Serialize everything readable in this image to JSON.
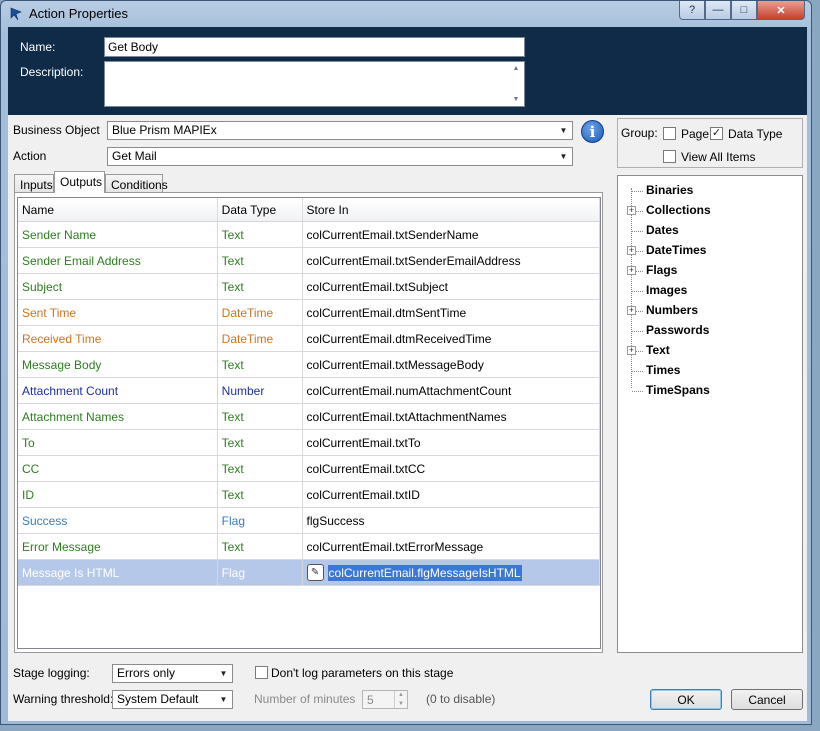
{
  "window": {
    "title": "Action Properties"
  },
  "header": {
    "name_label": "Name:",
    "name_value": "Get Body",
    "description_label": "Description:",
    "description_value": ""
  },
  "business_object": {
    "label": "Business Object",
    "value": "Blue Prism MAPIEx"
  },
  "action": {
    "label": "Action",
    "value": "Get Mail"
  },
  "tabs": [
    {
      "label": "Inputs"
    },
    {
      "label": "Outputs"
    },
    {
      "label": "Conditions"
    }
  ],
  "grid": {
    "columns": [
      "Name",
      "Data Type",
      "Store In"
    ],
    "rows": [
      {
        "name": "Sender Name",
        "type": "Text",
        "store": "colCurrentEmail.txtSenderName",
        "color": "#2e7d1f"
      },
      {
        "name": "Sender Email Address",
        "type": "Text",
        "store": "colCurrentEmail.txtSenderEmailAddress",
        "color": "#2e7d1f"
      },
      {
        "name": "Subject",
        "type": "Text",
        "store": "colCurrentEmail.txtSubject",
        "color": "#2e7d1f"
      },
      {
        "name": "Sent Time",
        "type": "DateTime",
        "store": "colCurrentEmail.dtmSentTime",
        "color": "#d4731a"
      },
      {
        "name": "Received Time",
        "type": "DateTime",
        "store": "colCurrentEmail.dtmReceivedTime",
        "color": "#d4731a"
      },
      {
        "name": "Message Body",
        "type": "Text",
        "store": "colCurrentEmail.txtMessageBody",
        "color": "#2e7d1f"
      },
      {
        "name": "Attachment Count",
        "type": "Number",
        "store": "colCurrentEmail.numAttachmentCount",
        "color": "#1c2fa8"
      },
      {
        "name": "Attachment Names",
        "type": "Text",
        "store": "colCurrentEmail.txtAttachmentNames",
        "color": "#2e7d1f"
      },
      {
        "name": "To",
        "type": "Text",
        "store": "colCurrentEmail.txtTo",
        "color": "#2e7d1f"
      },
      {
        "name": "CC",
        "type": "Text",
        "store": "colCurrentEmail.txtCC",
        "color": "#2e7d1f"
      },
      {
        "name": "ID",
        "type": "Text",
        "store": "colCurrentEmail.txtID",
        "color": "#2e7d1f"
      },
      {
        "name": "Success",
        "type": "Flag",
        "store": "flgSuccess",
        "color": "#3b7cb8"
      },
      {
        "name": "Error Message",
        "type": "Text",
        "store": "colCurrentEmail.txtErrorMessage",
        "color": "#2e7d1f"
      },
      {
        "name": "Message Is HTML",
        "type": "Flag",
        "store": "colCurrentEmail.flgMessageIsHTML",
        "color": "#ffffff"
      }
    ]
  },
  "group": {
    "label": "Group:",
    "page_label": "Page",
    "page_checked": false,
    "datatype_label": "Data Type",
    "datatype_checked": true,
    "view_all_label": "View All Items",
    "view_all_checked": false
  },
  "tree": [
    {
      "label": "Binaries",
      "expandable": false
    },
    {
      "label": "Collections",
      "expandable": true
    },
    {
      "label": "Dates",
      "expandable": false
    },
    {
      "label": "DateTimes",
      "expandable": true
    },
    {
      "label": "Flags",
      "expandable": true
    },
    {
      "label": "Images",
      "expandable": false
    },
    {
      "label": "Numbers",
      "expandable": true
    },
    {
      "label": "Passwords",
      "expandable": false
    },
    {
      "label": "Text",
      "expandable": true
    },
    {
      "label": "Times",
      "expandable": false
    },
    {
      "label": "TimeSpans",
      "expandable": false
    }
  ],
  "footer": {
    "stage_logging_label": "Stage logging:",
    "stage_logging_value": "Errors only",
    "dont_log_label": "Don't log parameters on this stage",
    "warning_label": "Warning threshold:",
    "warning_value": "System Default",
    "minutes_label": "Number of minutes",
    "minutes_value": "5",
    "disable_hint": "(0 to disable)",
    "ok_label": "OK",
    "cancel_label": "Cancel"
  },
  "titlebar_buttons": {
    "help": "?",
    "min": "—",
    "max": "□",
    "close": "✕"
  }
}
